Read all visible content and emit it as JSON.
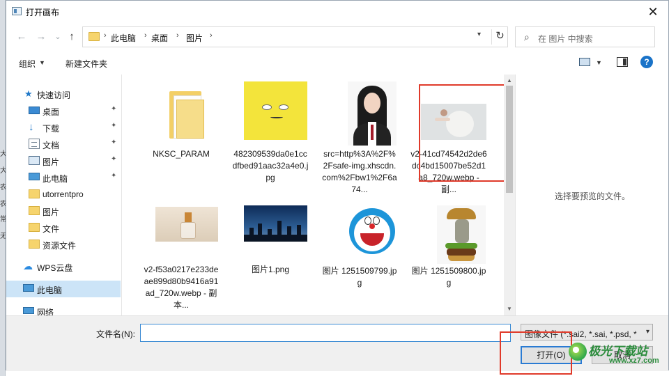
{
  "window": {
    "title": "打开画布",
    "close_glyph": "✕"
  },
  "nav": {
    "back_glyph": "←",
    "forward_glyph": "→",
    "recent_glyph": "⌄",
    "up_glyph": "↑",
    "breadcrumb": [
      "此电脑",
      "桌面",
      "图片"
    ],
    "separator": "›",
    "refresh_glyph": "↻",
    "search_placeholder": "在 图片 中搜索"
  },
  "toolbar": {
    "organize": "组织",
    "new_folder": "新建文件夹",
    "help": "?"
  },
  "sidebar": {
    "items": [
      {
        "label": "快速访问",
        "icon": "star-icon",
        "pinned": false
      },
      {
        "label": "桌面",
        "icon": "desktop-icon",
        "pinned": true
      },
      {
        "label": "下载",
        "icon": "download-icon",
        "pinned": true
      },
      {
        "label": "文档",
        "icon": "document-icon",
        "pinned": true
      },
      {
        "label": "图片",
        "icon": "pictures-icon",
        "pinned": true
      },
      {
        "label": "此电脑",
        "icon": "computer-icon",
        "pinned": true
      },
      {
        "label": "utorrentpro",
        "icon": "folder-icon",
        "pinned": false
      },
      {
        "label": "图片",
        "icon": "folder-icon",
        "pinned": false
      },
      {
        "label": "文件",
        "icon": "folder-icon",
        "pinned": false
      },
      {
        "label": "资源文件",
        "icon": "folder-icon",
        "pinned": false
      },
      {
        "label": "WPS云盘",
        "icon": "cloud-icon",
        "pinned": false
      },
      {
        "label": "此电脑",
        "icon": "computer-icon",
        "pinned": false,
        "selected": true
      },
      {
        "label": "网络",
        "icon": "network-icon",
        "pinned": false
      }
    ]
  },
  "files": [
    {
      "name": "NKSC_PARAM",
      "thumb": "folder"
    },
    {
      "name": "482309539da0e1ccdfbed91aac32a4e0.jpg",
      "thumb": "spongebob"
    },
    {
      "name": "src=http%3A%2F%2Fsafe-img.xhscdn.com%2Fbw1%2F6a74...",
      "thumb": "portrait"
    },
    {
      "name": "v2-41cd74542d2de6dc4bd15007be52d1a8_720w.webp - 副...",
      "thumb": "lady",
      "highlighted": true
    },
    {
      "name": "v2-f53a0217e233deae899d80b9416a91ad_720w.webp - 副本...",
      "thumb": "perfume"
    },
    {
      "name": "图片1.png",
      "thumb": "skyline"
    },
    {
      "name": "图片 1251509799.jpg",
      "thumb": "doraemon"
    },
    {
      "name": "图片 1251509800.jpg",
      "thumb": "burger"
    }
  ],
  "preview": {
    "message": "选择要预览的文件。"
  },
  "footer": {
    "filename_label": "文件名(N):",
    "filename_value": "",
    "file_type": "图像文件 (*.sai2, *.sai, *.psd, *",
    "open_button": "打开(O)",
    "cancel_button": "取消"
  },
  "watermark": {
    "line1": "极光下载站",
    "line2": "www.xz7.com"
  },
  "left_strip_chars": [
    "大",
    "大",
    "农",
    "农",
    "常",
    "无"
  ],
  "accent_color": "#2a7bd3",
  "highlight_color": "#e03a2a"
}
